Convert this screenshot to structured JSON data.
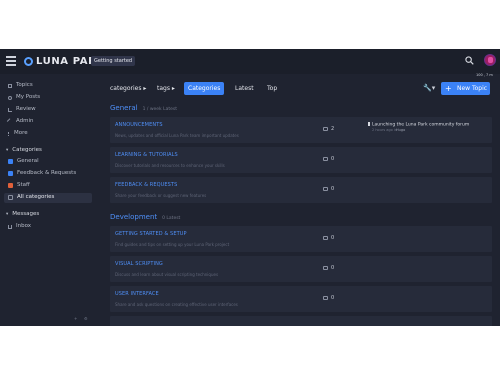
{
  "header": {
    "logo_text": "LUNA PARK",
    "getting_started": "Getting started",
    "counter": "100 , 7 m"
  },
  "sidebar": {
    "items": [
      {
        "label": "Topics",
        "icon": "topics-icon"
      },
      {
        "label": "My Posts",
        "icon": "posts-icon"
      },
      {
        "label": "Review",
        "icon": "review-icon"
      },
      {
        "label": "Admin",
        "icon": "admin-icon"
      },
      {
        "label": "More",
        "icon": "more-icon"
      }
    ],
    "categories_header": "Categories",
    "categories": [
      {
        "label": "General",
        "color": "#3b82f6"
      },
      {
        "label": "Feedback & Requests",
        "color": "#3b82f6"
      },
      {
        "label": "Staff",
        "color": "#e0603a"
      },
      {
        "label": "All categories",
        "color": "#8a90a0"
      }
    ],
    "messages_header": "Messages",
    "inbox": "Inbox"
  },
  "nav": {
    "categories_dropdown": "categories",
    "tags_dropdown": "tags",
    "tabs": [
      "Categories",
      "Latest",
      "Top"
    ],
    "new_topic": "New Topic"
  },
  "sections": [
    {
      "name": "General",
      "meta": "1 / week   Latest",
      "rows": [
        {
          "title": "ANNOUNCEMENTS",
          "desc": "News, updates and official Luna Park team important updates",
          "count": "2"
        },
        {
          "title": "LEARNING & TUTORIALS",
          "desc": "Discover tutorials and resources to enhance your skills",
          "count": "0"
        },
        {
          "title": "FEEDBACK & REQUESTS",
          "desc": "Share your feedback or suggest new features",
          "count": "0"
        }
      ]
    },
    {
      "name": "Development",
      "meta": "0   Latest",
      "rows": [
        {
          "title": "GETTING STARTED & SETUP",
          "desc": "Find guides and tips on setting up your Luna Park project",
          "count": "0"
        },
        {
          "title": "VISUAL SCRIPTING",
          "desc": "Discuss and learn about visual scripting techniques",
          "count": "0"
        },
        {
          "title": "USER INTERFACE",
          "desc": "Share and ask questions on creating effective user interfaces",
          "count": "0"
        }
      ]
    }
  ],
  "latest_topic": {
    "title": "Launching the Luna Park community forum",
    "sub": "2 hours ago in",
    "user": "Hugo"
  }
}
